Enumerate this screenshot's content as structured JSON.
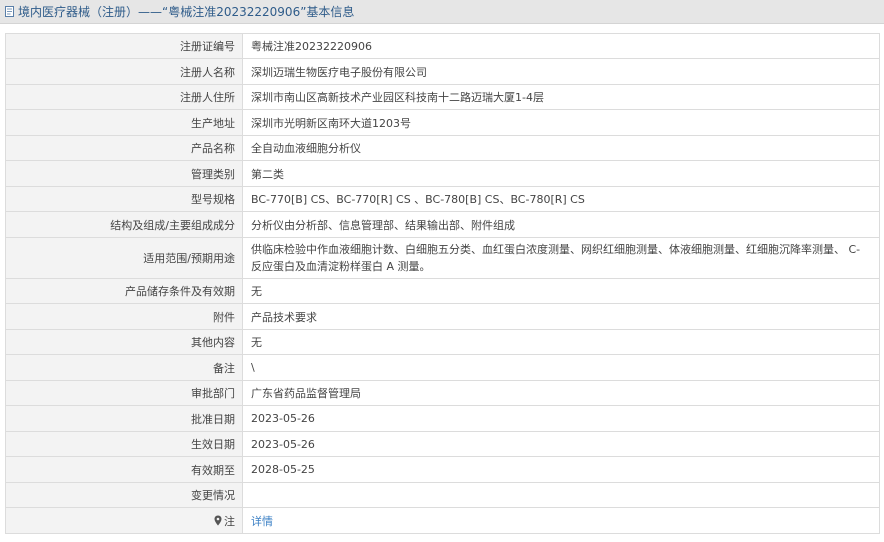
{
  "header": {
    "title": "境内医疗器械（注册）——“粤械注准20232220906”基本信息"
  },
  "rows": [
    {
      "label": "注册证编号",
      "value": "粤械注准20232220906"
    },
    {
      "label": "注册人名称",
      "value": "深圳迈瑞生物医疗电子股份有限公司"
    },
    {
      "label": "注册人住所",
      "value": "深圳市南山区高新技术产业园区科技南十二路迈瑞大厦1-4层"
    },
    {
      "label": "生产地址",
      "value": "深圳市光明新区南环大道1203号"
    },
    {
      "label": "产品名称",
      "value": "全自动血液细胞分析仪"
    },
    {
      "label": "管理类别",
      "value": "第二类"
    },
    {
      "label": "型号规格",
      "value": "BC-770[B] CS、BC-770[R] CS 、BC-780[B] CS、BC-780[R] CS"
    },
    {
      "label": "结构及组成/主要组成成分",
      "value": "分析仪由分析部、信息管理部、结果输出部、附件组成"
    },
    {
      "label": "适用范围/预期用途",
      "value": "供临床检验中作血液细胞计数、白细胞五分类、血红蛋白浓度测量、网织红细胞测量、体液细胞测量、红细胞沉降率测量、 C- 反应蛋白及血清淀粉样蛋白 A 测量。"
    },
    {
      "label": "产品储存条件及有效期",
      "value": "无"
    },
    {
      "label": "附件",
      "value": "产品技术要求"
    },
    {
      "label": "其他内容",
      "value": "无"
    },
    {
      "label": "备注",
      "value": "\\"
    },
    {
      "label": "审批部门",
      "value": "广东省药品监督管理局"
    },
    {
      "label": "批准日期",
      "value": "2023-05-26"
    },
    {
      "label": "生效日期",
      "value": "2023-05-26"
    },
    {
      "label": "有效期至",
      "value": "2028-05-25"
    },
    {
      "label": "变更情况",
      "value": ""
    },
    {
      "label": "注",
      "value": "详情"
    }
  ]
}
